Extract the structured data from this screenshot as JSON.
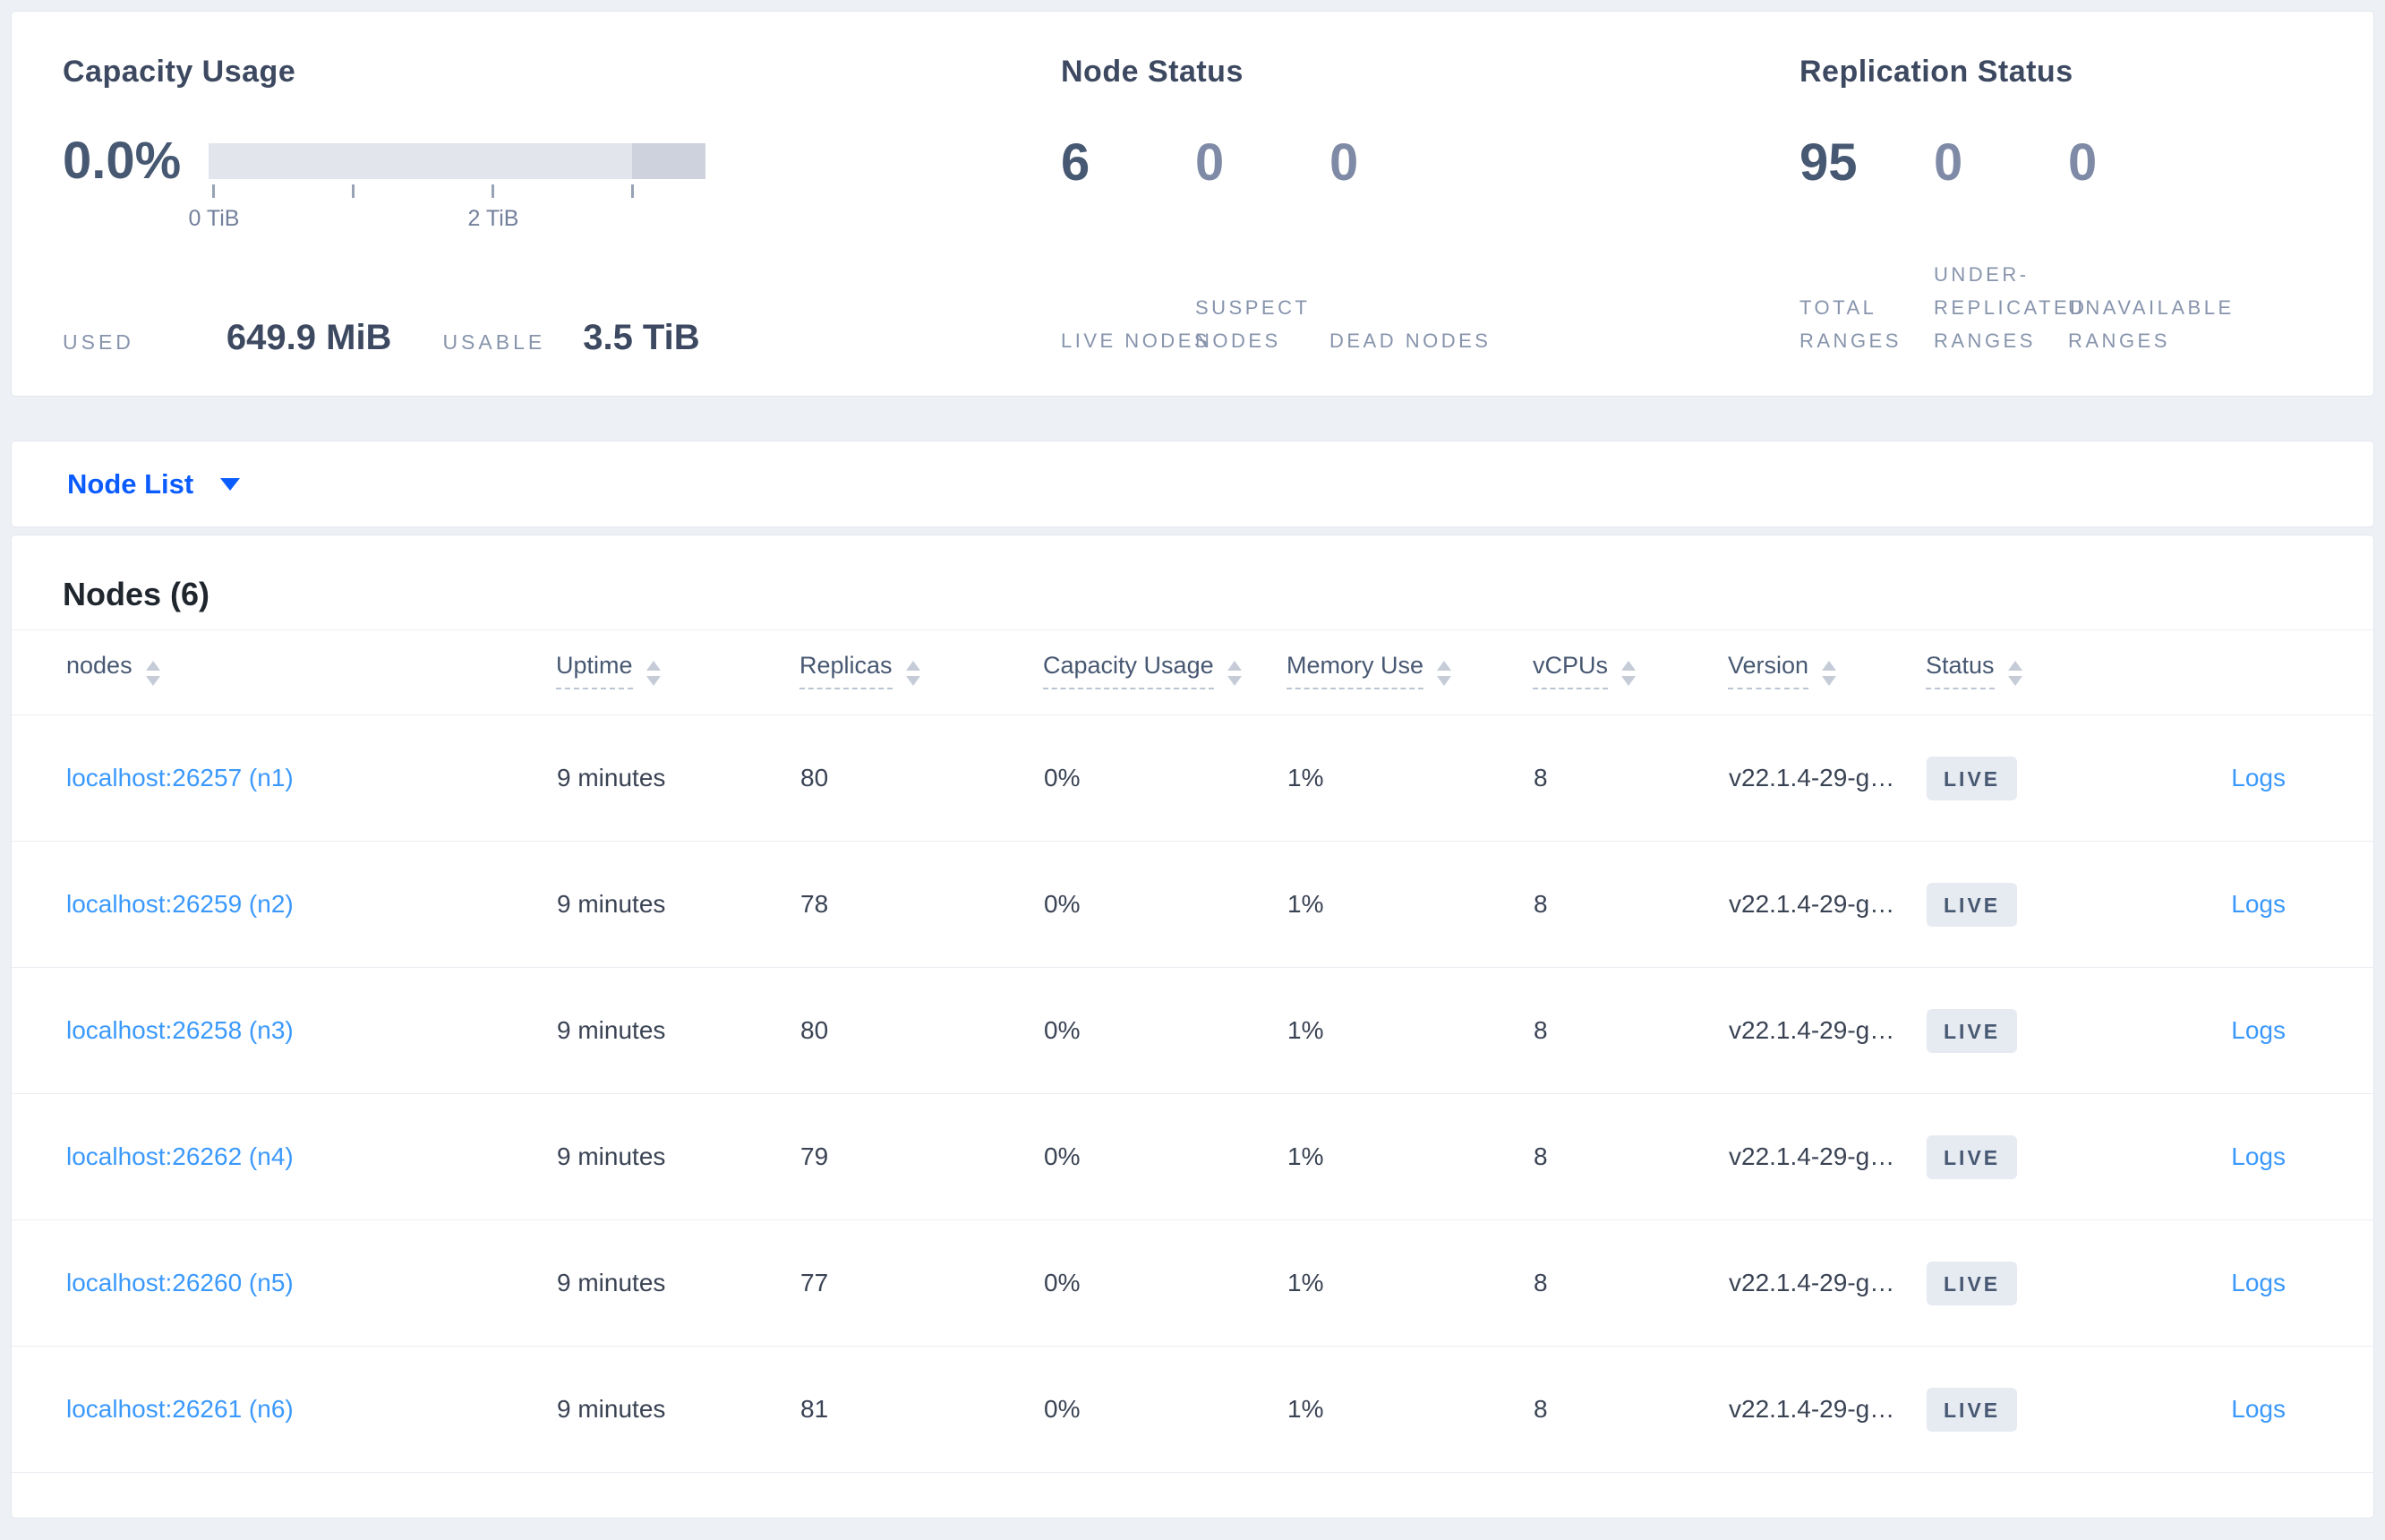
{
  "summary": {
    "capacity": {
      "title": "Capacity Usage",
      "percent": "0.0%",
      "tick_labels": {
        "zero": "0 TiB",
        "two": "2 TiB"
      },
      "used_label": "USED",
      "used_value": "649.9 MiB",
      "usable_label": "USABLE",
      "usable_value": "3.5 TiB"
    },
    "node_status": {
      "title": "Node Status",
      "stats": [
        {
          "value": "6",
          "label": "LIVE NODES"
        },
        {
          "value": "0",
          "label": "SUSPECT NODES"
        },
        {
          "value": "0",
          "label": "DEAD NODES"
        }
      ]
    },
    "replication": {
      "title": "Replication Status",
      "stats": [
        {
          "value": "95",
          "label": "TOTAL RANGES"
        },
        {
          "value": "0",
          "label": "UNDER-REPLICATED RANGES"
        },
        {
          "value": "0",
          "label": "UNAVAILABLE RANGES"
        }
      ]
    }
  },
  "view_selector": {
    "label": "Node List"
  },
  "nodes_table": {
    "title": "Nodes (6)",
    "columns": [
      {
        "label": "nodes"
      },
      {
        "label": "Uptime"
      },
      {
        "label": "Replicas"
      },
      {
        "label": "Capacity Usage"
      },
      {
        "label": "Memory Use"
      },
      {
        "label": "vCPUs"
      },
      {
        "label": "Version"
      },
      {
        "label": "Status"
      }
    ],
    "logs_label": "Logs",
    "rows": [
      {
        "name": "localhost:26257 (n1)",
        "uptime": "9 minutes",
        "replicas": "80",
        "capacity": "0%",
        "memory": "1%",
        "vcpus": "8",
        "version": "v22.1.4-29-g…",
        "status": "LIVE"
      },
      {
        "name": "localhost:26259 (n2)",
        "uptime": "9 minutes",
        "replicas": "78",
        "capacity": "0%",
        "memory": "1%",
        "vcpus": "8",
        "version": "v22.1.4-29-g…",
        "status": "LIVE"
      },
      {
        "name": "localhost:26258 (n3)",
        "uptime": "9 minutes",
        "replicas": "80",
        "capacity": "0%",
        "memory": "1%",
        "vcpus": "8",
        "version": "v22.1.4-29-g…",
        "status": "LIVE"
      },
      {
        "name": "localhost:26262 (n4)",
        "uptime": "9 minutes",
        "replicas": "79",
        "capacity": "0%",
        "memory": "1%",
        "vcpus": "8",
        "version": "v22.1.4-29-g…",
        "status": "LIVE"
      },
      {
        "name": "localhost:26260 (n5)",
        "uptime": "9 minutes",
        "replicas": "77",
        "capacity": "0%",
        "memory": "1%",
        "vcpus": "8",
        "version": "v22.1.4-29-g…",
        "status": "LIVE"
      },
      {
        "name": "localhost:26261 (n6)",
        "uptime": "9 minutes",
        "replicas": "81",
        "capacity": "0%",
        "memory": "1%",
        "vcpus": "8",
        "version": "v22.1.4-29-g…",
        "status": "LIVE"
      }
    ]
  },
  "colors": {
    "page_background": "#edf0f5",
    "accent_blue": "#0b5cff",
    "link_blue": "#3b99fc",
    "stat_dark": "#475872",
    "stat_muted": "#7f8ba6",
    "bar_light": "#e2e5ec",
    "bar_dark": "#cdd2dd",
    "live_badge_bg": "#e6eaf1",
    "live_badge_text": "#475872"
  }
}
